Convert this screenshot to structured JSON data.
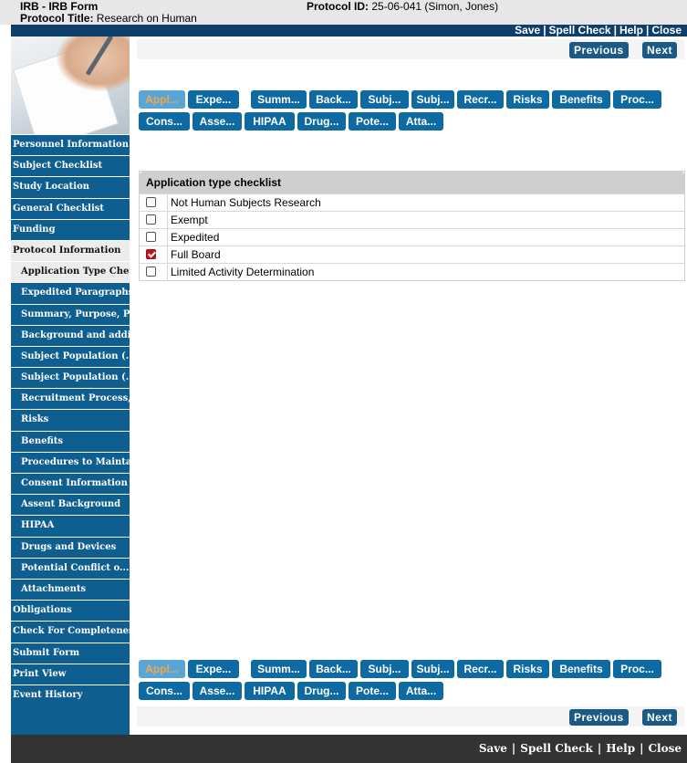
{
  "header": {
    "form_title": "IRB - IRB Form",
    "protocol_title_label": "Protocol Title:",
    "protocol_title_value": "Research on Human",
    "protocol_id_label": "Protocol ID:",
    "protocol_id_value": "25-06-041 (Simon, Jones)"
  },
  "actions": {
    "save": "Save",
    "spell_check": "Spell Check",
    "help": "Help",
    "close": "Close",
    "separator": "|"
  },
  "nav": {
    "previous": "Previous",
    "next": "Next"
  },
  "sidebar": {
    "items": [
      {
        "label": "Personnel Information",
        "sub": false,
        "selected": false
      },
      {
        "label": "Subject Checklist",
        "sub": false,
        "selected": false
      },
      {
        "label": "Study Location",
        "sub": false,
        "selected": false
      },
      {
        "label": "General Checklist",
        "sub": false,
        "selected": false
      },
      {
        "label": "Funding",
        "sub": false,
        "selected": false
      },
      {
        "label": "Protocol Information",
        "sub": false,
        "selected": true
      },
      {
        "label": "Application Type Che...",
        "sub": true,
        "selected": true
      },
      {
        "label": "Expedited Paragraphs",
        "sub": true,
        "selected": false
      },
      {
        "label": "Summary, Purpose, Pr...",
        "sub": true,
        "selected": false
      },
      {
        "label": "Background and addit...",
        "sub": true,
        "selected": false
      },
      {
        "label": "Subject Population (...",
        "sub": true,
        "selected": false
      },
      {
        "label": "Subject Population (...",
        "sub": true,
        "selected": false
      },
      {
        "label": "Recruitment Process,...",
        "sub": true,
        "selected": false
      },
      {
        "label": "Risks",
        "sub": true,
        "selected": false
      },
      {
        "label": "Benefits",
        "sub": true,
        "selected": false
      },
      {
        "label": "Procedures to Mainta...",
        "sub": true,
        "selected": false
      },
      {
        "label": "Consent Information",
        "sub": true,
        "selected": false
      },
      {
        "label": "Assent Background",
        "sub": true,
        "selected": false
      },
      {
        "label": "HIPAA",
        "sub": true,
        "selected": false
      },
      {
        "label": "Drugs and Devices",
        "sub": true,
        "selected": false
      },
      {
        "label": "Potential Conflict o...",
        "sub": true,
        "selected": false
      },
      {
        "label": "Attachments",
        "sub": true,
        "selected": false
      },
      {
        "label": "Obligations",
        "sub": false,
        "selected": false
      },
      {
        "label": "Check For Completeness",
        "sub": false,
        "selected": false
      },
      {
        "label": "Submit Form",
        "sub": false,
        "selected": false
      },
      {
        "label": "Print View",
        "sub": false,
        "selected": false
      },
      {
        "label": "Event History",
        "sub": false,
        "selected": false
      }
    ]
  },
  "tabs": [
    {
      "label": "Appl...",
      "active": true
    },
    {
      "label": "Expe...",
      "active": false
    },
    {
      "label": "Summ...",
      "active": false
    },
    {
      "label": "Back...",
      "active": false
    },
    {
      "label": "Subj...",
      "active": false
    },
    {
      "label": "Subj...",
      "active": false
    },
    {
      "label": "Recr...",
      "active": false
    },
    {
      "label": "Risks",
      "active": false
    },
    {
      "label": "Benefits",
      "active": false
    },
    {
      "label": "Proc...",
      "active": false
    },
    {
      "label": "Cons...",
      "active": false
    },
    {
      "label": "Asse...",
      "active": false
    },
    {
      "label": "HIPAA",
      "active": false
    },
    {
      "label": "Drug...",
      "active": false
    },
    {
      "label": "Pote...",
      "active": false
    },
    {
      "label": "Atta...",
      "active": false
    }
  ],
  "checklist": {
    "title": "Application type checklist",
    "items": [
      {
        "label": "Not Human Subjects Research",
        "checked": false
      },
      {
        "label": "Exempt",
        "checked": false
      },
      {
        "label": "Expedited",
        "checked": false
      },
      {
        "label": "Full Board",
        "checked": true
      },
      {
        "label": "Limited Activity Determination",
        "checked": false
      }
    ]
  },
  "colors": {
    "header_bar": "#0e3f6b",
    "sidebar": "#0e5f8f",
    "tab": "#0e6aa3",
    "tab_active": "#5aa5d8",
    "tab_active_text": "#f5a54a",
    "nav_button": "#1b5a84",
    "bottom_bar": "#333333",
    "checked_box": "#c4121c"
  }
}
